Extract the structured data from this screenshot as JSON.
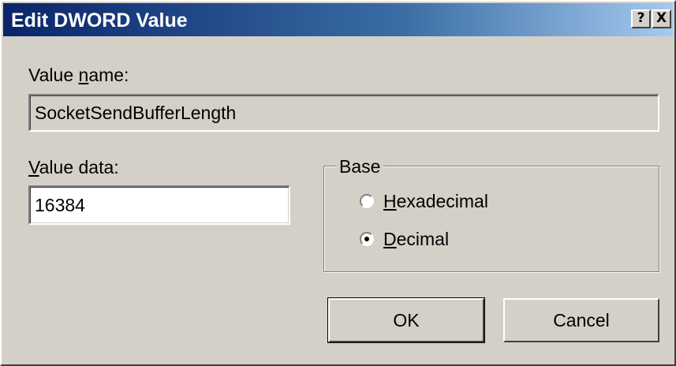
{
  "dialog": {
    "title": "Edit DWORD Value",
    "help_button": "?",
    "close_button": "X"
  },
  "value_name": {
    "label_pre": "Value ",
    "label_accel": "n",
    "label_post": "ame:",
    "value": "SocketSendBufferLength"
  },
  "value_data": {
    "label_accel": "V",
    "label_post": "alue data:",
    "value": "16384"
  },
  "base": {
    "legend": "Base",
    "options": [
      {
        "accel": "H",
        "rest": "exadecimal",
        "selected": false
      },
      {
        "accel": "D",
        "rest": "ecimal",
        "selected": true
      }
    ]
  },
  "buttons": {
    "ok": "OK",
    "cancel": "Cancel"
  }
}
